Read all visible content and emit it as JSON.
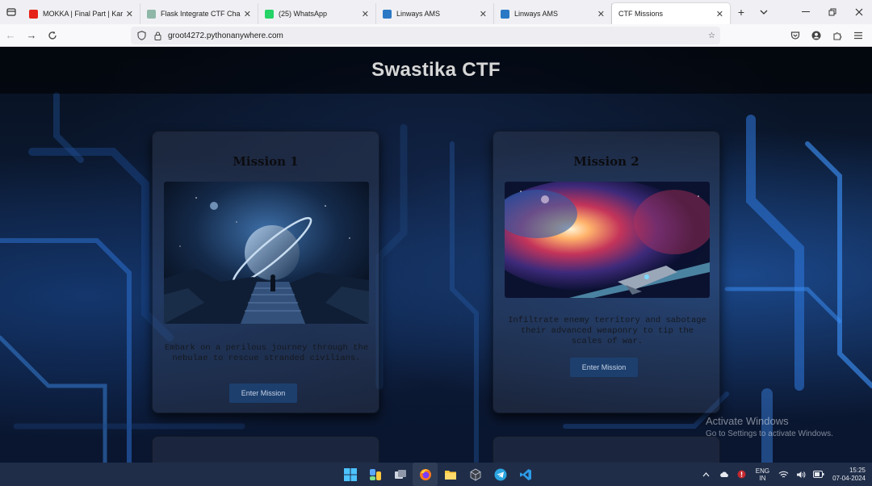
{
  "browser": {
    "tabs": [
      {
        "label": "MOKKA | Final Part | Karikku",
        "favicon_color": "#e62117",
        "active": false
      },
      {
        "label": "Flask Integrate CTF Challeng",
        "favicon_color": "#8fb7a8",
        "active": false
      },
      {
        "label": "(25) WhatsApp",
        "favicon_color": "#25d366",
        "active": false
      },
      {
        "label": "Linways AMS",
        "favicon_color": "#2b78c5",
        "active": false
      },
      {
        "label": "Linways AMS",
        "favicon_color": "#2b78c5",
        "active": false
      },
      {
        "label": "CTF Missions",
        "favicon_color": "",
        "active": true
      }
    ],
    "url": "groot4272.pythonanywhere.com"
  },
  "page": {
    "title": "Swastika CTF",
    "missions": [
      {
        "title": "Mission 1",
        "description": "Embark on a perilous journey through the nebulae to rescue stranded civilians.",
        "button": "Enter Mission",
        "art": "planet-ringed-space-scene"
      },
      {
        "title": "Mission 2",
        "description": "Infiltrate enemy territory and sabotage their advanced weaponry to tip the scales of war.",
        "button": "Enter Mission",
        "art": "nebula-spaceship-scene"
      }
    ]
  },
  "watermark": {
    "line1": "Activate Windows",
    "line2": "Go to Settings to activate Windows."
  },
  "taskbar": {
    "apps": [
      "windows-start",
      "widgets",
      "task-view",
      "firefox",
      "file-explorer",
      "app-box",
      "telegram",
      "vscode"
    ],
    "language": {
      "line1": "ENG",
      "line2": "IN"
    },
    "time": "15:25",
    "date": "07-04-2024"
  }
}
